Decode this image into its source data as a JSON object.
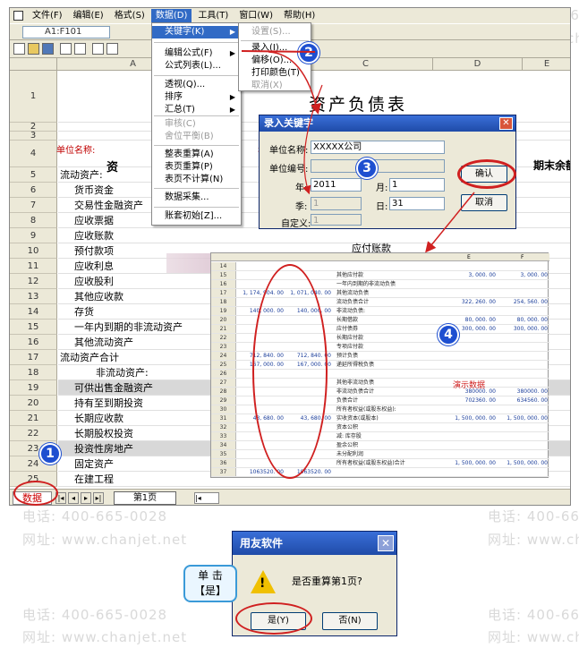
{
  "app": {
    "menu": [
      "文件(F)",
      "编辑(E)",
      "格式(S)",
      "数据(D)",
      "工具(T)",
      "窗口(W)",
      "帮助(H)"
    ],
    "cell_ref": "A1:F101",
    "columns": [
      "A",
      "B",
      "C",
      "D",
      "E"
    ]
  },
  "sheet": {
    "title": "资产负债表",
    "unit_label": "单位名称:",
    "year_label": "年",
    "assets_header": "资 产",
    "end_balance_header": "期末余额",
    "payable_label": "应付账款",
    "rows": [
      {
        "n": "1",
        "text": ""
      },
      {
        "n": "2",
        "text": ""
      },
      {
        "n": "3",
        "text": ""
      },
      {
        "n": "4",
        "text": ""
      },
      {
        "n": "5",
        "text": "流动资产:"
      },
      {
        "n": "6",
        "text": "货币资金"
      },
      {
        "n": "7",
        "text": "交易性金融资产"
      },
      {
        "n": "8",
        "text": "应收票据"
      },
      {
        "n": "9",
        "text": "应收账款"
      },
      {
        "n": "10",
        "text": "预付款项"
      },
      {
        "n": "11",
        "text": "应收利息"
      },
      {
        "n": "12",
        "text": "应收股利"
      },
      {
        "n": "13",
        "text": "其他应收款"
      },
      {
        "n": "14",
        "text": "存货"
      },
      {
        "n": "15",
        "text": "一年内到期的非流动资产"
      },
      {
        "n": "16",
        "text": "其他流动资产"
      },
      {
        "n": "17",
        "text": "流动资产合计"
      },
      {
        "n": "18",
        "text": "非流动资产:"
      },
      {
        "n": "19",
        "text": "可供出售金融资产"
      },
      {
        "n": "20",
        "text": "持有至到期投资"
      },
      {
        "n": "21",
        "text": "长期应收款"
      },
      {
        "n": "22",
        "text": "长期股权投资"
      },
      {
        "n": "23",
        "text": "投资性房地产"
      },
      {
        "n": "24",
        "text": "固定资产"
      },
      {
        "n": "25",
        "text": "在建工程"
      }
    ],
    "tabs": {
      "data": "数据",
      "page1": "第1页"
    }
  },
  "data_menu": {
    "items": [
      {
        "label": "关键字(K)"
      },
      {
        "label": "编辑公式(F)"
      },
      {
        "label": "公式列表(L)..."
      },
      {
        "label": "透视(Q)..."
      },
      {
        "label": "排序"
      },
      {
        "label": "汇总(T)"
      },
      {
        "label": "审核(C)"
      },
      {
        "label": "舍位平衡(B)"
      },
      {
        "label": "整表重算(A)"
      },
      {
        "label": "表页重算(P)"
      },
      {
        "label": "表页不计算(N)"
      },
      {
        "label": "数据采集..."
      },
      {
        "label": "账套初始[Z]..."
      }
    ]
  },
  "keyword_submenu": {
    "items": [
      {
        "label": "设置(S)..."
      },
      {
        "label": "录入(I)..."
      },
      {
        "label": "偏移(O)..."
      },
      {
        "label": "打印颜色(T)"
      },
      {
        "label": "取消(X)"
      }
    ]
  },
  "keyword_dialog": {
    "title": "录入关键字",
    "unit_name_label": "单位名称:",
    "unit_name_value": "XXXXX公司",
    "unit_code_label": "单位编号:",
    "year_label": "年:",
    "year_value": "2011",
    "month_label": "月:",
    "month_value": "1",
    "quarter_label": "季:",
    "quarter_value": "1",
    "day_label": "日:",
    "day_value": "31",
    "custom_label": "自定义:",
    "custom_value": "1",
    "ok_label": "确认",
    "cancel_label": "取消"
  },
  "inset": {
    "col_e": "E",
    "col_f": "F",
    "demo_label": "演示数据",
    "rows": [
      {
        "n": "14",
        "a": "",
        "b": "",
        "label": "",
        "c": "",
        "d": ""
      },
      {
        "n": "15",
        "a": "",
        "b": "",
        "label": "其他应付款",
        "c": "3, 000. 00",
        "d": "3, 000. 00"
      },
      {
        "n": "16",
        "a": "",
        "b": "",
        "label": "一年内到期的非流动负债",
        "c": "",
        "d": ""
      },
      {
        "n": "17",
        "a": "1, 174, 904. 00",
        "b": "1, 071, 040. 00",
        "label": "其他流动负债",
        "c": "",
        "d": ""
      },
      {
        "n": "18",
        "a": "",
        "b": "",
        "label": "流动负债合计",
        "c": "322, 260. 00",
        "d": "254, 560. 00"
      },
      {
        "n": "19",
        "a": "140, 000. 00",
        "b": "140, 000. 00",
        "label": "非流动负债:",
        "c": "",
        "d": ""
      },
      {
        "n": "20",
        "a": "",
        "b": "",
        "label": "长期借款",
        "c": "80, 000. 00",
        "d": "80, 000. 00"
      },
      {
        "n": "21",
        "a": "",
        "b": "",
        "label": "应付债券",
        "c": "300, 000. 00",
        "d": "300, 000. 00"
      },
      {
        "n": "22",
        "a": "",
        "b": "",
        "label": "长期应付款",
        "c": "",
        "d": ""
      },
      {
        "n": "23",
        "a": "",
        "b": "",
        "label": "专项应付款",
        "c": "",
        "d": ""
      },
      {
        "n": "24",
        "a": "712, 840. 00",
        "b": "712, 840. 00",
        "label": "预计负债",
        "c": "",
        "d": ""
      },
      {
        "n": "25",
        "a": "167, 000. 00",
        "b": "167, 000. 00",
        "label": "递延所得税负债",
        "c": "",
        "d": ""
      },
      {
        "n": "26",
        "a": "",
        "b": "",
        "label": "",
        "c": "",
        "d": ""
      },
      {
        "n": "27",
        "a": "",
        "b": "",
        "label": "其他非流动负债",
        "c": "",
        "d": ""
      },
      {
        "n": "28",
        "a": "",
        "b": "",
        "label": "非流动负债合计",
        "c": "380000. 00",
        "d": "380000. 00"
      },
      {
        "n": "29",
        "a": "",
        "b": "",
        "label": "负债合计",
        "c": "702360. 00",
        "d": "634560. 00"
      },
      {
        "n": "30",
        "a": "",
        "b": "",
        "label": "所有者权益(或股东权益):",
        "c": "",
        "d": ""
      },
      {
        "n": "31",
        "a": "43, 680. 00",
        "b": "43, 680. 00",
        "label": "实收资本(或股本)",
        "c": "1, 500, 000. 00",
        "d": "1, 500, 000. 00"
      },
      {
        "n": "32",
        "a": "",
        "b": "",
        "label": "资本公积",
        "c": "",
        "d": ""
      },
      {
        "n": "33",
        "a": "",
        "b": "",
        "label": "减: 库存股",
        "c": "",
        "d": ""
      },
      {
        "n": "34",
        "a": "",
        "b": "",
        "label": "盈余公积",
        "c": "",
        "d": ""
      },
      {
        "n": "35",
        "a": "",
        "b": "",
        "label": "未分配利润",
        "c": "",
        "d": ""
      },
      {
        "n": "36",
        "a": "",
        "b": "",
        "label": "所有者权益(或股东权益)合计",
        "c": "1, 500, 000. 00",
        "d": "1, 500, 000. 00"
      },
      {
        "n": "37",
        "a": "1063520. 00",
        "b": "1063520. 00",
        "label": "",
        "c": "",
        "d": ""
      }
    ]
  },
  "confirm_dialog": {
    "title": "用友软件",
    "message": "是否重算第1页?",
    "yes_label": "是(Y)",
    "no_label": "否(N)"
  },
  "callout": {
    "line1": "单 击",
    "line2": "【是】"
  },
  "badges": [
    "1",
    "2",
    "3",
    "4"
  ],
  "watermark": {
    "phone": "电话: 400-665-0028",
    "site": "网址: www.chanjet.net"
  }
}
